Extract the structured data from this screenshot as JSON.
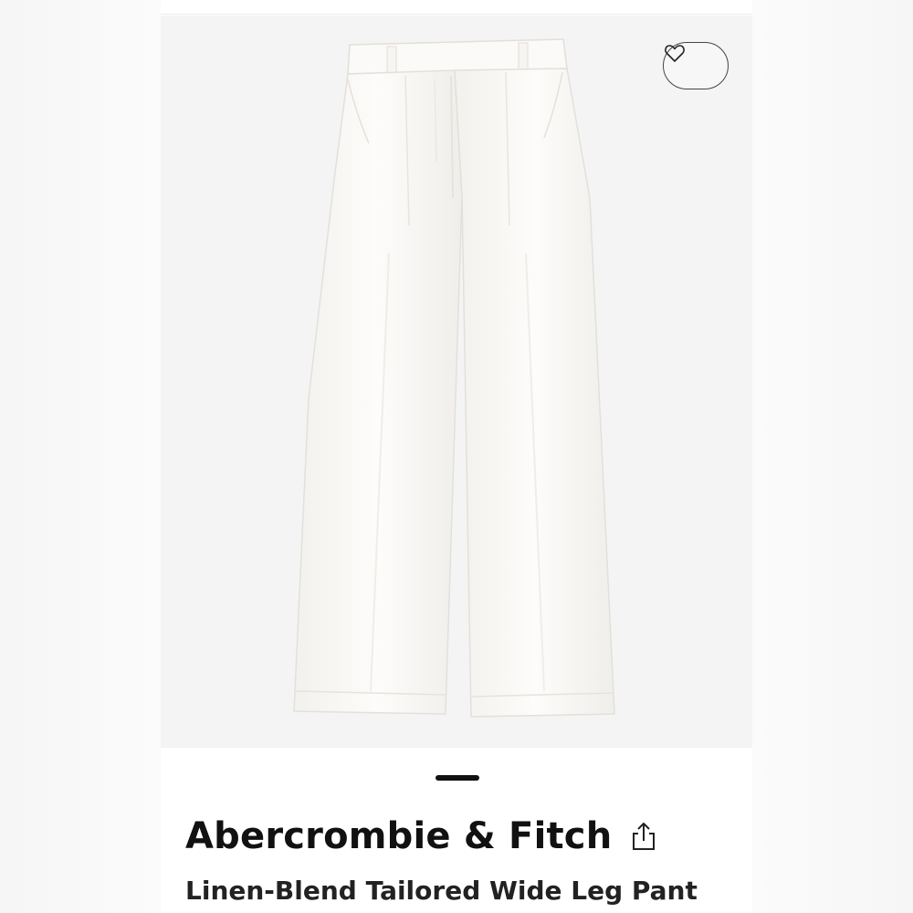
{
  "product": {
    "brand": "Abercrombie & Fitch",
    "title": "Linen-Blend Tailored Wide Leg Pant"
  },
  "icons": {
    "wishlist": "heart-outline-icon",
    "share": "share-icon"
  },
  "colors": {
    "image_background": "#f4f4f4",
    "garment": "#fbfaf8",
    "text": "#111111"
  }
}
